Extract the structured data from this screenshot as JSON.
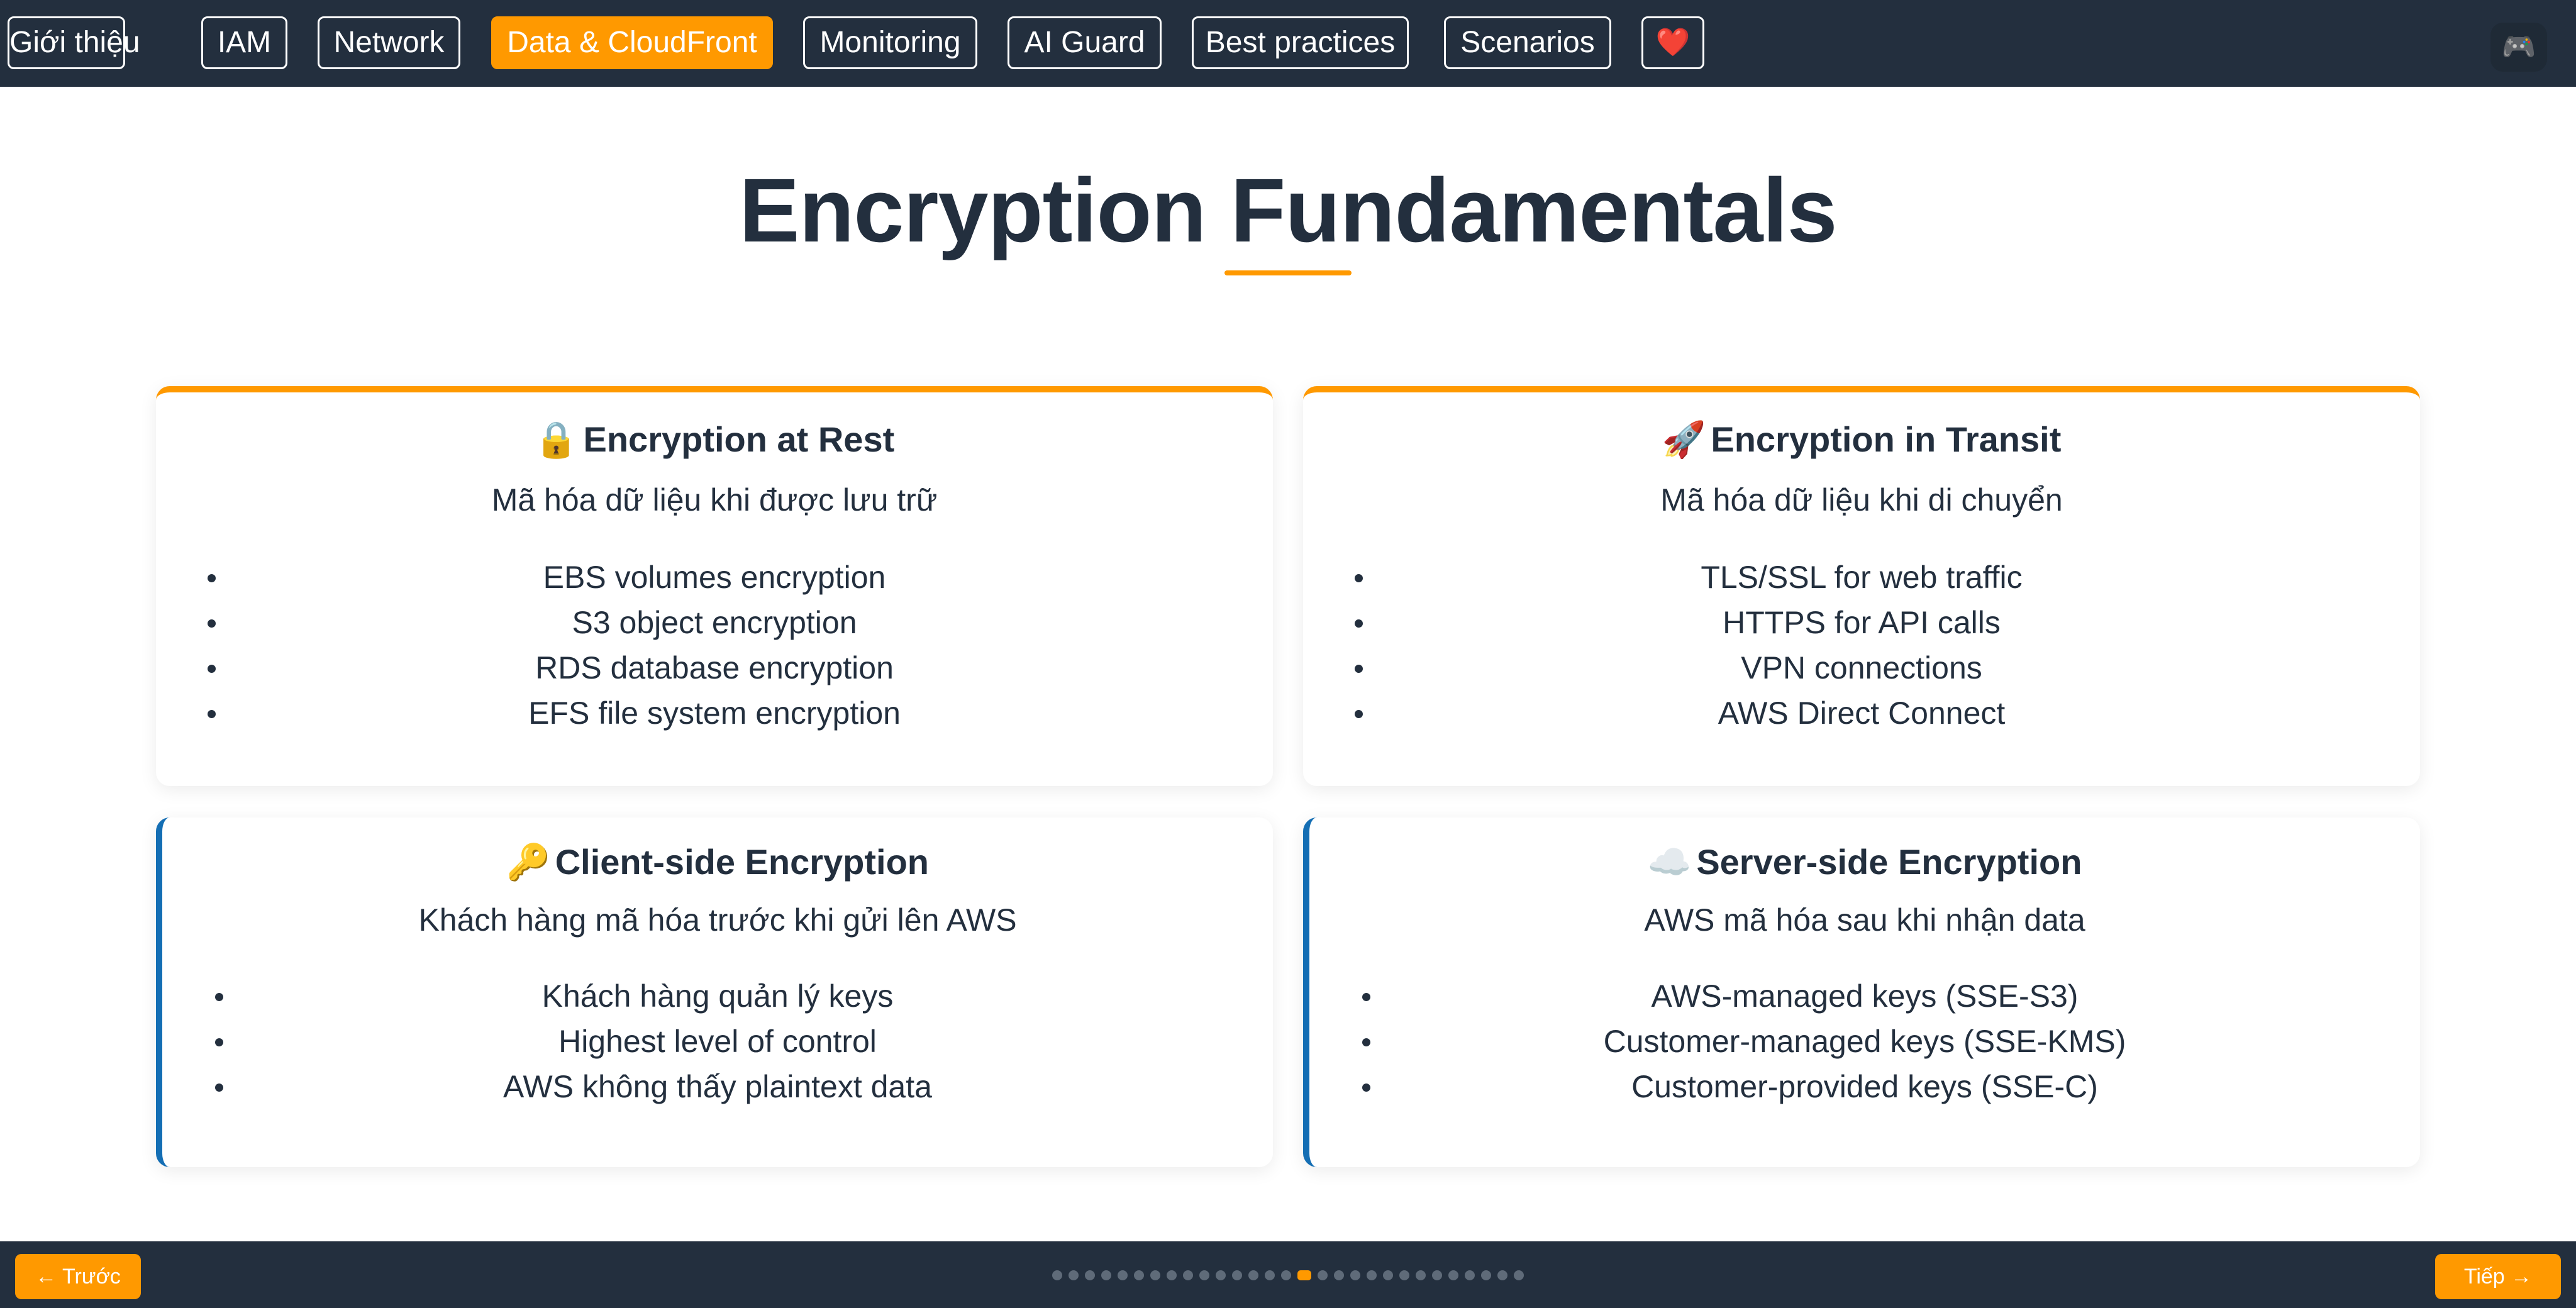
{
  "nav": {
    "items": [
      {
        "label": "Giới thiệu"
      },
      {
        "label": "IAM"
      },
      {
        "label": "Network"
      },
      {
        "label": "Data & CloudFront"
      },
      {
        "label": "Monitoring"
      },
      {
        "label": "AI Guard"
      },
      {
        "label": "Best practices"
      },
      {
        "label": "Scenarios"
      },
      {
        "label": "❤️"
      }
    ],
    "active": "Data & CloudFront",
    "gamepad_icon": "🎮"
  },
  "page": {
    "title": "Encryption Fundamentals"
  },
  "cards": [
    {
      "icon": "🔒",
      "title": "Encryption at Rest",
      "subtitle": "Mã hóa dữ liệu khi được lưu trữ",
      "items": [
        "EBS volumes encryption",
        "S3 object encryption",
        "RDS database encryption",
        "EFS file system encryption"
      ]
    },
    {
      "icon": "🚀",
      "title": "Encryption in Transit",
      "subtitle": "Mã hóa dữ liệu khi di chuyển",
      "items": [
        "TLS/SSL for web traffic",
        "HTTPS for API calls",
        "VPN connections",
        "AWS Direct Connect"
      ]
    },
    {
      "icon": "🔑",
      "title": "Client-side Encryption",
      "subtitle": "Khách hàng mã hóa trước khi gửi lên AWS",
      "items": [
        "Khách hàng quản lý keys",
        "Highest level of control",
        "AWS không thấy plaintext data"
      ]
    },
    {
      "icon": "☁️",
      "title": "Server-side Encryption",
      "subtitle": "AWS mã hóa sau khi nhận data",
      "items": [
        "AWS-managed keys (SSE-S3)",
        "Customer-managed keys (SSE-KMS)",
        "Customer-provided keys (SSE-C)"
      ]
    }
  ],
  "pagination": {
    "prev_label": "← Trước",
    "next_label": "Tiếp →",
    "total_slides": 29,
    "current_slide": 16
  },
  "colors": {
    "accent": "#ff9900",
    "navy": "#232f3e",
    "blue": "#146eb4"
  }
}
